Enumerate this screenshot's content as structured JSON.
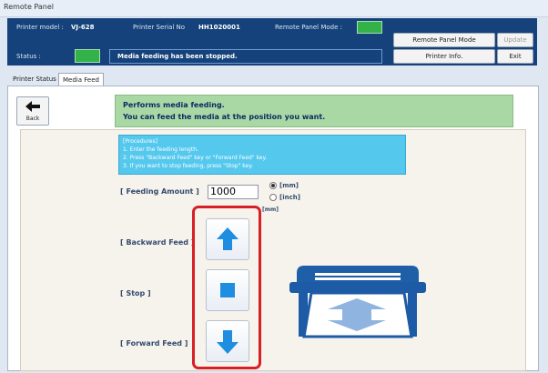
{
  "window": {
    "title": "Remote Panel"
  },
  "header": {
    "printer_model_label": "Printer model :",
    "printer_model_value": "VJ-628",
    "serial_label": "Printer Serial No",
    "serial_value": "HH1020001",
    "mode_label": "Remote Panel Mode :",
    "status_label": "Status :",
    "status_message": "Media feeding has been stopped.",
    "indicator_color": "#33b24a"
  },
  "buttons": {
    "remote_panel_mode": "Remote Panel Mode",
    "update": "Update",
    "printer_info": "Printer Info.",
    "exit": "Exit"
  },
  "tabs": [
    {
      "label": "Printer Status"
    },
    {
      "label": "Media Feed"
    }
  ],
  "back": {
    "label": "Back"
  },
  "banner": {
    "line1": "Performs media feeding.",
    "line2": "You can feed the media at the position you want."
  },
  "procedures": {
    "title": "[Procedures]",
    "steps": [
      "1. Enter the feeding length.",
      "2. Press \"Backward Feed\" key or \"Forward Feed\" key.",
      "3. If you want to stop feeding, press \"Stop\" key."
    ]
  },
  "feed": {
    "amount_label": "[ Feeding Amount ]",
    "amount_value": "1000",
    "unit_mm": "[mm]",
    "unit_inch": "[inch]",
    "unit_small": "[mm]",
    "selected_unit": "mm"
  },
  "controls": {
    "backward_label": "[ Backward Feed ]",
    "stop_label": "[ Stop ]",
    "forward_label": "[ Forward Feed ]"
  },
  "colors": {
    "accent_blue": "#1f8ee0",
    "highlight_red": "#d81f26",
    "header_bg": "#15427a"
  }
}
